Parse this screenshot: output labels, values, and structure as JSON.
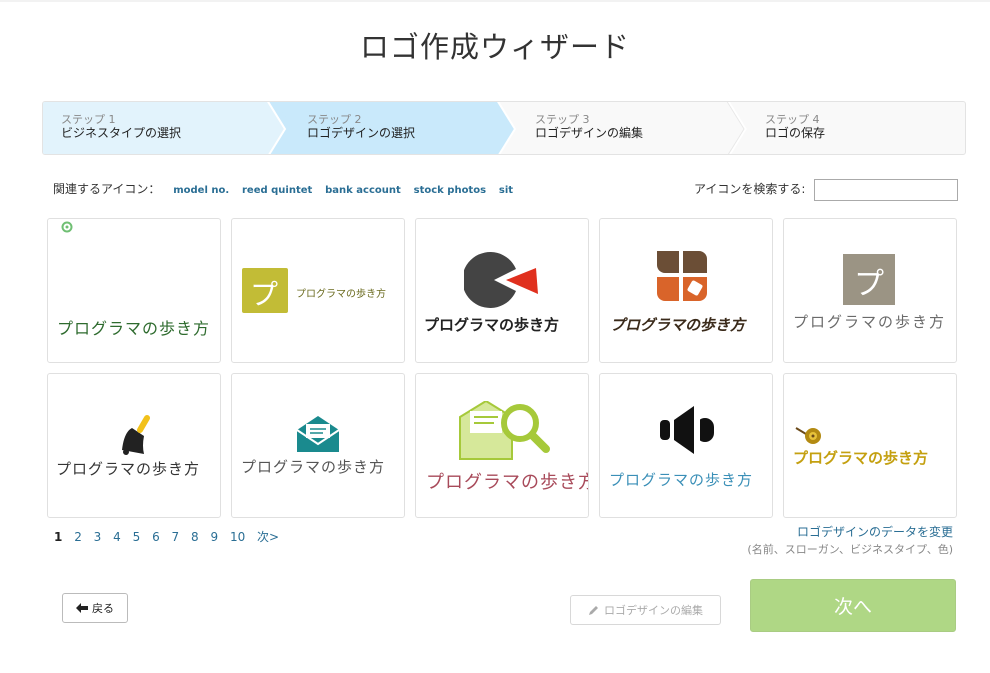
{
  "title": "ロゴ作成ウィザード",
  "steps": [
    {
      "num": "ステップ 1",
      "name": "ビジネスタイプの選択"
    },
    {
      "num": "ステップ 2",
      "name": "ロゴデザインの選択"
    },
    {
      "num": "ステップ 3",
      "name": "ロゴデザインの編集"
    },
    {
      "num": "ステップ 4",
      "name": "ロゴの保存"
    }
  ],
  "related": {
    "label": "関連するアイコン：",
    "tags": [
      "model no.",
      "reed quintet",
      "bank account",
      "stock photos",
      "sit"
    ]
  },
  "search": {
    "label": "アイコンを検索する:",
    "value": ""
  },
  "logo_text": "プログラマの歩き方",
  "icon_char": "プ",
  "pagination": {
    "pages": [
      "1",
      "2",
      "3",
      "4",
      "5",
      "6",
      "7",
      "8",
      "9",
      "10"
    ],
    "next": "次>",
    "current": "1"
  },
  "change_link": "ロゴデザインのデータを変更",
  "change_note": "(名前、スローガン、ビジネスタイプ、色)",
  "buttons": {
    "back": "戻る",
    "edit": "ロゴデザインの編集",
    "next": "次へ"
  },
  "colors": {
    "accent_green": "#afd785",
    "link": "#2a6e94"
  }
}
